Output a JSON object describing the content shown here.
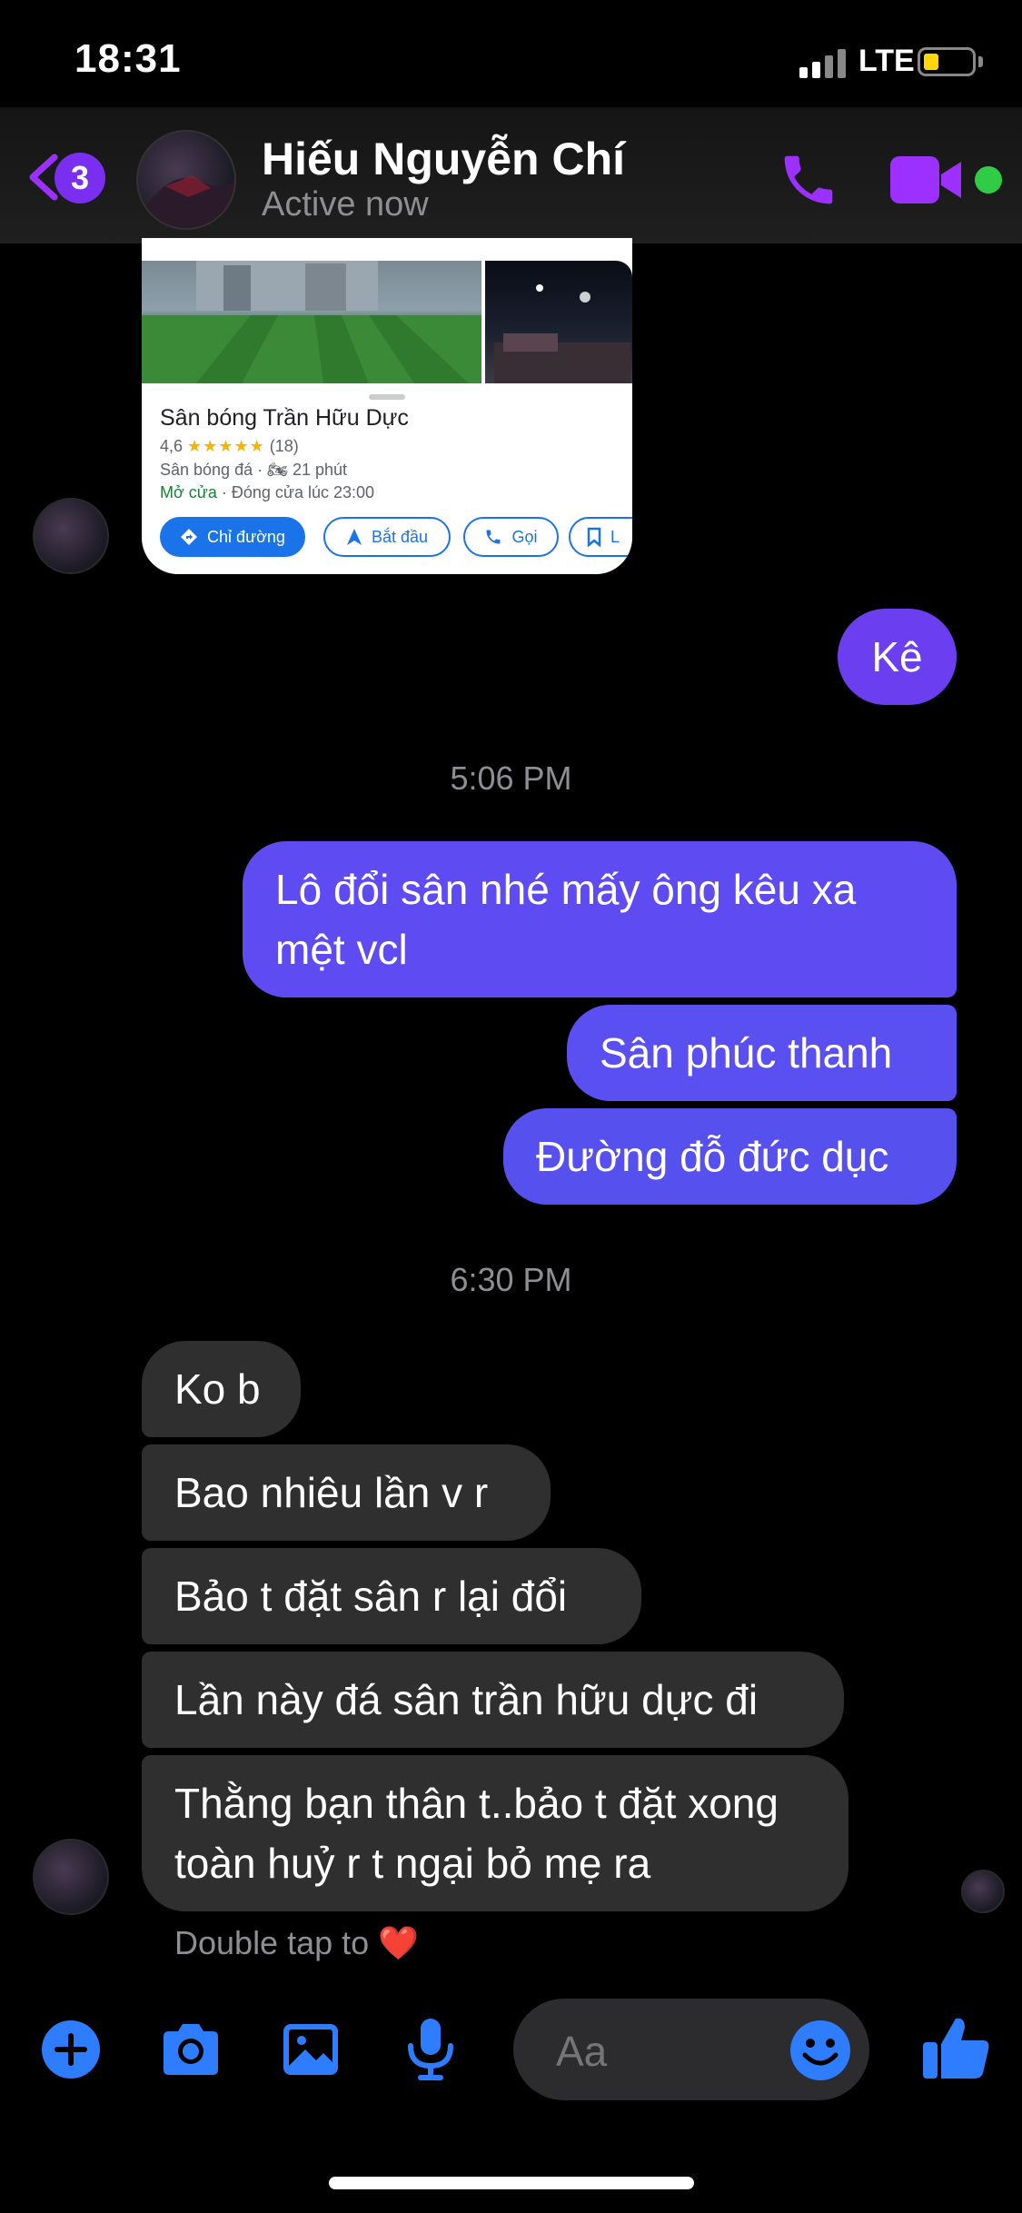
{
  "status_bar": {
    "time": "18:31",
    "network": "LTE"
  },
  "header": {
    "back_badge": "3",
    "contact_name": "Hiếu Nguyễn Chí",
    "contact_status": "Active now"
  },
  "map_card": {
    "place_name": "Sân bóng Trần Hữu Dực",
    "rating": "4,6",
    "stars": "★★★★★",
    "review_count": "(18)",
    "category": "Sân bóng đá",
    "travel_time": "21 phút",
    "open_status": "Mở cửa",
    "closing": "· Đóng cửa lúc 23:00",
    "buttons": {
      "directions": "Chỉ đường",
      "start": "Bắt đầu",
      "call": "Gọi",
      "save": "L"
    }
  },
  "messages": {
    "ke": "Kê",
    "time1": "5:06 PM",
    "lo_doi_san": "Lô đổi sân nhé mấy ông kêu xa mệt vcl",
    "san_phuc_thanh": "Sân phúc thanh",
    "duong_do_duc_duc": "Đường đỗ đức dục",
    "time2": "6:30 PM",
    "ko_b": "Ko b",
    "bao_nhieu": "Bao nhiêu lần v r",
    "bao_t": "Bảo t đặt sân r lại đổi",
    "lan_nay": "Lần này đá sân trần hữu dực đi",
    "thang_ban": "Thằng bạn thân t..bảo t đặt xong toàn huỷ r t ngại bỏ mẹ ra"
  },
  "double_tap": {
    "text": "Double tap to",
    "heart": "❤️"
  },
  "composer": {
    "placeholder": "Aa"
  },
  "colors": {
    "accent": "#9b30ff",
    "outgoing": "#5a4ff0",
    "incoming": "#2f2f2f",
    "icon_blue": "#2e7dff"
  }
}
